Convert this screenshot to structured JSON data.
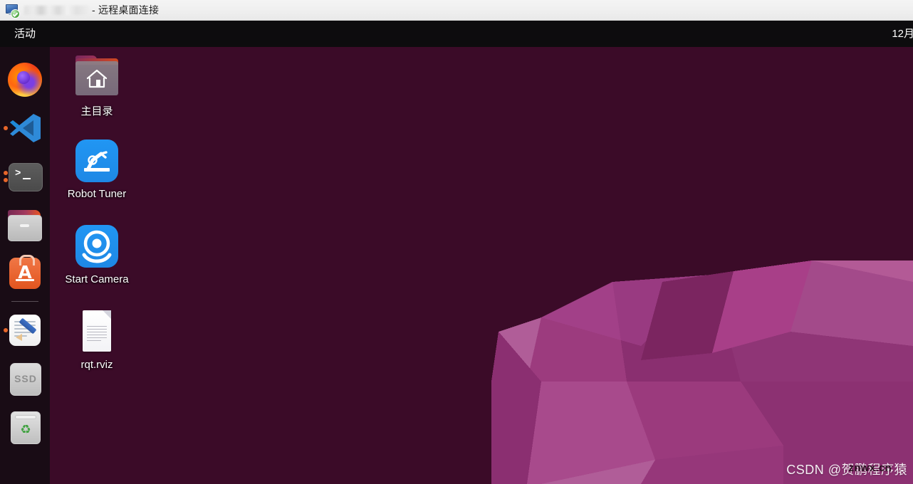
{
  "window": {
    "title_suffix": "- 远程桌面连接",
    "title_redacted": true,
    "icon": "remote-desktop-icon"
  },
  "top_panel": {
    "activities_label": "活动",
    "clock": "12月"
  },
  "dock": {
    "items": [
      {
        "name": "firefox",
        "label": "Firefox Web Browser",
        "running_dots": 0
      },
      {
        "name": "vscode",
        "label": "Visual Studio Code",
        "running_dots": 1
      },
      {
        "name": "terminal",
        "label": "Terminal",
        "running_dots": 2
      },
      {
        "name": "files",
        "label": "Files",
        "running_dots": 0
      },
      {
        "name": "ubuntu-software",
        "label": "Ubuntu Software",
        "running_dots": 0
      },
      {
        "name": "text-editor",
        "label": "Text Editor",
        "running_dots": 1
      },
      {
        "name": "ssd-drive",
        "label": "SSD",
        "running_dots": 0
      },
      {
        "name": "trash",
        "label": "Trash",
        "running_dots": 0
      }
    ],
    "ssd_label": "SSD",
    "software_letter": "A",
    "recycle_glyph": "♻"
  },
  "desktop": {
    "icons": [
      {
        "name": "home-folder",
        "label": "主目录"
      },
      {
        "name": "robot-tuner",
        "label": "Robot Tuner"
      },
      {
        "name": "start-camera",
        "label": "Start Camera"
      },
      {
        "name": "rqt-rviz-file",
        "label": "rqt.rviz"
      }
    ]
  },
  "watermarks": {
    "csdn": "CSDN @贺鹏程序猿",
    "site": "znwx.cn"
  },
  "colors": {
    "desktop_bg": "#3b0b28",
    "panel_bg": "#0d0c0e",
    "dock_bg": "#140c12",
    "titlebar_bg": "#f0f0f0",
    "accent_orange": "#e8662a",
    "app_blue": "#2196f3",
    "wallpaper_mid": "#9c3b7e",
    "wallpaper_light": "#b35a96"
  }
}
